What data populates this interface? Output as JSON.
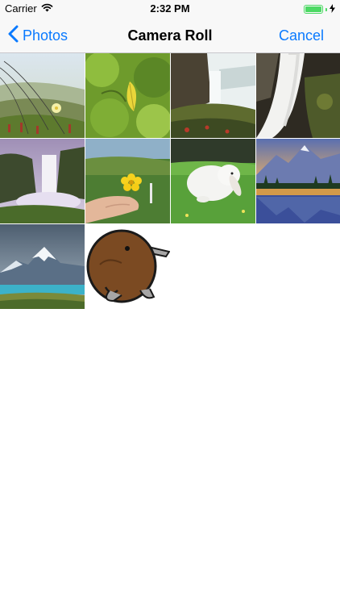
{
  "status_bar": {
    "carrier": "Carrier",
    "time": "2:32 PM",
    "wifi_icon": "wifi-icon",
    "battery_icon": "battery-icon",
    "charging_icon": "charging-bolt-icon",
    "battery_level": 1.0
  },
  "nav": {
    "back_label": "Photos",
    "title": "Camera Roll",
    "cancel_label": "Cancel",
    "tint_color": "#0a7aff"
  },
  "photos": [
    {
      "name": "photo-beach-dunes-flower"
    },
    {
      "name": "photo-yellow-leaf"
    },
    {
      "name": "photo-waterfall-cliff"
    },
    {
      "name": "photo-waterfall-rocks"
    },
    {
      "name": "photo-misty-waterfall"
    },
    {
      "name": "photo-hand-yellow-flower"
    },
    {
      "name": "photo-white-rabbit"
    },
    {
      "name": "photo-mountain-lake-reflection"
    },
    {
      "name": "photo-snowy-mountain-lake"
    },
    {
      "name": "photo-kiwi-bird-illustration"
    }
  ]
}
